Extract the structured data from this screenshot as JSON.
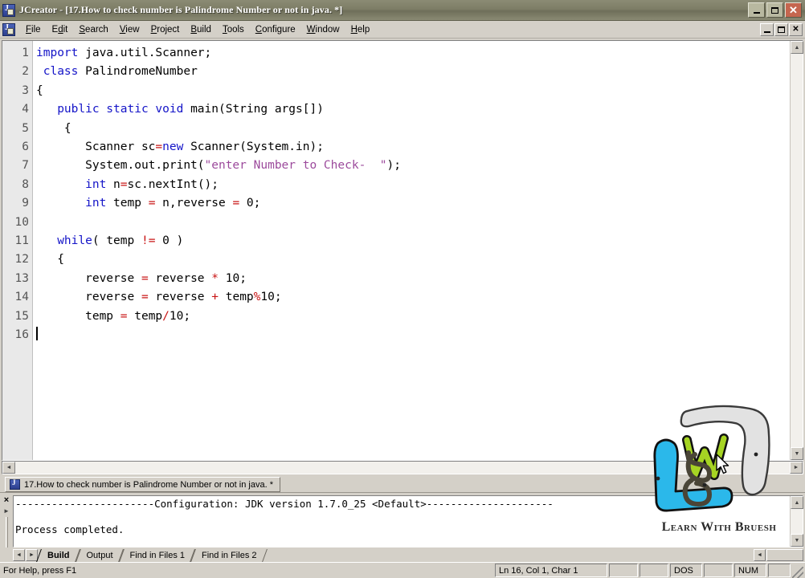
{
  "window": {
    "app_name": "JCreator",
    "title": "JCreator - [17.How to check number is Palindrome Number or not in java. *]",
    "app_icon": "jcreator-icon",
    "controls": {
      "minimize": "minimize-button",
      "maximize": "maximize-button",
      "close": "close-button"
    }
  },
  "menubar": {
    "doc_icon": "java-document-icon",
    "items": [
      {
        "label": "File",
        "mnemonic": "F"
      },
      {
        "label": "Edit",
        "mnemonic": "d"
      },
      {
        "label": "Search",
        "mnemonic": "S"
      },
      {
        "label": "View",
        "mnemonic": "V"
      },
      {
        "label": "Project",
        "mnemonic": "P"
      },
      {
        "label": "Build",
        "mnemonic": "B"
      },
      {
        "label": "Tools",
        "mnemonic": "T"
      },
      {
        "label": "Configure",
        "mnemonic": "C"
      },
      {
        "label": "Window",
        "mnemonic": "W"
      },
      {
        "label": "Help",
        "mnemonic": "H"
      }
    ],
    "mdi_controls": {
      "minimize": "_",
      "restore": "❐",
      "close": "✕"
    }
  },
  "editor": {
    "line_numbers": [
      "1",
      "2",
      "3",
      "4",
      "5",
      "6",
      "7",
      "8",
      "9",
      "10",
      "11",
      "12",
      "13",
      "14",
      "15",
      "16"
    ],
    "lines": [
      {
        "n": 1,
        "tokens": [
          {
            "t": "import",
            "c": "kw"
          },
          {
            "t": " java.util.Scanner;",
            "c": "plain"
          }
        ]
      },
      {
        "n": 2,
        "tokens": [
          {
            "t": " ",
            "c": "plain"
          },
          {
            "t": "class",
            "c": "kw"
          },
          {
            "t": " PalindromeNumber",
            "c": "plain"
          }
        ]
      },
      {
        "n": 3,
        "tokens": [
          {
            "t": "{",
            "c": "plain"
          }
        ]
      },
      {
        "n": 4,
        "tokens": [
          {
            "t": "   ",
            "c": "plain"
          },
          {
            "t": "public static void",
            "c": "kw"
          },
          {
            "t": " main(String args[])",
            "c": "plain"
          }
        ]
      },
      {
        "n": 5,
        "tokens": [
          {
            "t": "    {",
            "c": "plain"
          }
        ]
      },
      {
        "n": 6,
        "tokens": [
          {
            "t": "       Scanner sc",
            "c": "plain"
          },
          {
            "t": "=",
            "c": "op"
          },
          {
            "t": "new",
            "c": "kw"
          },
          {
            "t": " Scanner(System.in);",
            "c": "plain"
          }
        ]
      },
      {
        "n": 7,
        "tokens": [
          {
            "t": "       System.out.print(",
            "c": "plain"
          },
          {
            "t": "\"enter Number to Check-  \"",
            "c": "str"
          },
          {
            "t": ");",
            "c": "plain"
          }
        ]
      },
      {
        "n": 8,
        "tokens": [
          {
            "t": "       ",
            "c": "plain"
          },
          {
            "t": "int",
            "c": "kw"
          },
          {
            "t": " n",
            "c": "plain"
          },
          {
            "t": "=",
            "c": "op"
          },
          {
            "t": "sc.nextInt();",
            "c": "plain"
          }
        ]
      },
      {
        "n": 9,
        "tokens": [
          {
            "t": "       ",
            "c": "plain"
          },
          {
            "t": "int",
            "c": "kw"
          },
          {
            "t": " temp ",
            "c": "plain"
          },
          {
            "t": "=",
            "c": "op"
          },
          {
            "t": " n,reverse ",
            "c": "plain"
          },
          {
            "t": "=",
            "c": "op"
          },
          {
            "t": " 0;",
            "c": "plain"
          }
        ]
      },
      {
        "n": 10,
        "tokens": [
          {
            "t": "",
            "c": "plain"
          }
        ]
      },
      {
        "n": 11,
        "tokens": [
          {
            "t": "   ",
            "c": "plain"
          },
          {
            "t": "while",
            "c": "kw"
          },
          {
            "t": "( temp ",
            "c": "plain"
          },
          {
            "t": "!=",
            "c": "op"
          },
          {
            "t": " 0 )",
            "c": "plain"
          }
        ]
      },
      {
        "n": 12,
        "tokens": [
          {
            "t": "   {",
            "c": "plain"
          }
        ]
      },
      {
        "n": 13,
        "tokens": [
          {
            "t": "       reverse ",
            "c": "plain"
          },
          {
            "t": "=",
            "c": "op"
          },
          {
            "t": " reverse ",
            "c": "plain"
          },
          {
            "t": "*",
            "c": "op"
          },
          {
            "t": " 10;",
            "c": "plain"
          }
        ]
      },
      {
        "n": 14,
        "tokens": [
          {
            "t": "       reverse ",
            "c": "plain"
          },
          {
            "t": "=",
            "c": "op"
          },
          {
            "t": " reverse ",
            "c": "plain"
          },
          {
            "t": "+",
            "c": "op"
          },
          {
            "t": " temp",
            "c": "plain"
          },
          {
            "t": "%",
            "c": "op"
          },
          {
            "t": "10;",
            "c": "plain"
          }
        ]
      },
      {
        "n": 15,
        "tokens": [
          {
            "t": "       temp ",
            "c": "plain"
          },
          {
            "t": "=",
            "c": "op"
          },
          {
            "t": " temp",
            "c": "plain"
          },
          {
            "t": "/",
            "c": "op"
          },
          {
            "t": "10;",
            "c": "plain"
          }
        ]
      },
      {
        "n": 16,
        "tokens": [
          {
            "t": "",
            "c": "plain"
          }
        ]
      }
    ],
    "caret_line": 16,
    "colors": {
      "keyword": "#1414c8",
      "operator": "#c81414",
      "string": "#9c4a9c",
      "plain": "#000000",
      "background": "#ffffff",
      "gutter_background": "#e9e9e9"
    }
  },
  "document_tabs": [
    {
      "label": "17.How to check number is Palindrome Number or not in java. *",
      "active": true,
      "icon": "java-file-icon"
    }
  ],
  "output_pane": {
    "close_label": "×",
    "text_line_1": "-----------------------Configuration: JDK version 1.7.0_25 <Default>---------------------",
    "text_line_2": "",
    "text_line_3": "Process completed.",
    "tabs": [
      {
        "label": "Build",
        "active": true
      },
      {
        "label": "Output",
        "active": false
      },
      {
        "label": "Find in Files 1",
        "active": false
      },
      {
        "label": "Find in Files 2",
        "active": false
      }
    ],
    "nav_prev": "◄",
    "nav_next": "►"
  },
  "statusbar": {
    "help_text": "For Help, press F1",
    "position": "Ln 16, Col 1, Char 1",
    "cell_blank_1": "",
    "cell_blank_2": "",
    "line_ending": "DOS",
    "cell_blank_3": "",
    "num_lock": "NUM",
    "cell_blank_4": ""
  },
  "watermark": {
    "text": "Learn With Bruesh",
    "letters": {
      "l": "L",
      "w": "W",
      "b": "B"
    },
    "colors": {
      "l": "#29b6e8",
      "w": "#9acd32",
      "b": "#555044",
      "bracket": "#d8d8d8"
    }
  },
  "scrollbars": {
    "up": "▲",
    "down": "▼",
    "left": "◄",
    "right": "►"
  }
}
